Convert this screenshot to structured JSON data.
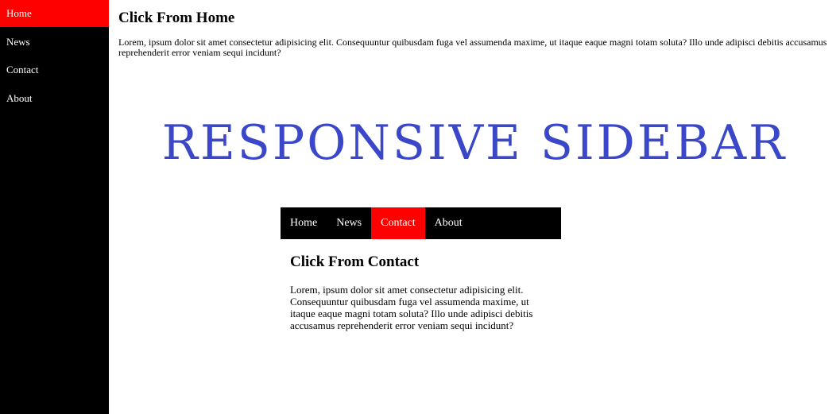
{
  "sidebar": {
    "items": [
      {
        "label": "Home",
        "active": true
      },
      {
        "label": "News",
        "active": false
      },
      {
        "label": "Contact",
        "active": false
      },
      {
        "label": "About",
        "active": false
      }
    ]
  },
  "top": {
    "heading": "Click From Home",
    "text": "Lorem, ipsum dolor sit amet consectetur adipisicing elit. Consequuntur quibusdam fuga vel assumenda maxime, ut itaque eaque magni totam soluta? Illo unde adipisci debitis accusamus reprehenderit error veniam sequi incidunt?"
  },
  "hero": {
    "title": "Responsive Sidebar"
  },
  "topnav": {
    "items": [
      {
        "label": "Home",
        "active": false
      },
      {
        "label": "News",
        "active": false
      },
      {
        "label": "Contact",
        "active": true
      },
      {
        "label": "About",
        "active": false
      }
    ]
  },
  "panel": {
    "heading": "Click From Contact",
    "text": "Lorem, ipsum dolor sit amet consectetur adipisicing elit. Consequuntur quibusdam fuga vel assumenda maxime, ut itaque eaque magni totam soluta? Illo unde adipisci debitis accusamus reprehenderit error veniam sequi incidunt?"
  },
  "colors": {
    "sidebar_bg": "#000000",
    "active_bg": "#ff0000",
    "hero_title": "#3b47c9",
    "nav_text": "#ffffff"
  }
}
